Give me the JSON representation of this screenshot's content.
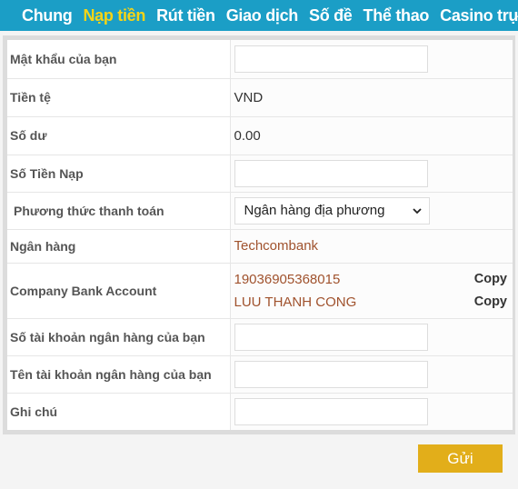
{
  "nav": {
    "items": [
      {
        "label": "Chung",
        "active": false
      },
      {
        "label": "Nạp tiền",
        "active": true
      },
      {
        "label": "Rút tiền",
        "active": false
      },
      {
        "label": "Giao dịch",
        "active": false
      },
      {
        "label": "Số đề",
        "active": false
      },
      {
        "label": "Thể thao",
        "active": false
      },
      {
        "label": "Casino trực tuyến",
        "active": false
      }
    ]
  },
  "form": {
    "password": {
      "label": "Mật khẩu của bạn",
      "value": ""
    },
    "currency": {
      "label": "Tiền tệ",
      "value": "VND"
    },
    "balance": {
      "label": "Số dư",
      "value": "0.00"
    },
    "amount": {
      "label": "Số Tiền Nạp",
      "value": ""
    },
    "payment_method": {
      "label": "Phương thức thanh toán",
      "selected": "Ngân hàng địa phương"
    },
    "bank": {
      "label": "Ngân hàng",
      "value": "Techcombank"
    },
    "company_account": {
      "label": "Company Bank Account",
      "account_number": "19036905368015",
      "account_name": "LUU THANH CONG",
      "copy_label": "Copy"
    },
    "your_account_number": {
      "label": "Số tài khoản ngân hàng của bạn",
      "value": ""
    },
    "your_account_name": {
      "label": "Tên tài khoản ngân hàng của bạn",
      "value": ""
    },
    "note": {
      "label": "Ghi chú",
      "value": ""
    },
    "submit_label": "Gửi"
  },
  "colors": {
    "nav_bg": "#1b9ec6",
    "nav_active": "#f5d416",
    "bank_text": "#a0522d",
    "submit_bg": "#e2ae1a"
  }
}
